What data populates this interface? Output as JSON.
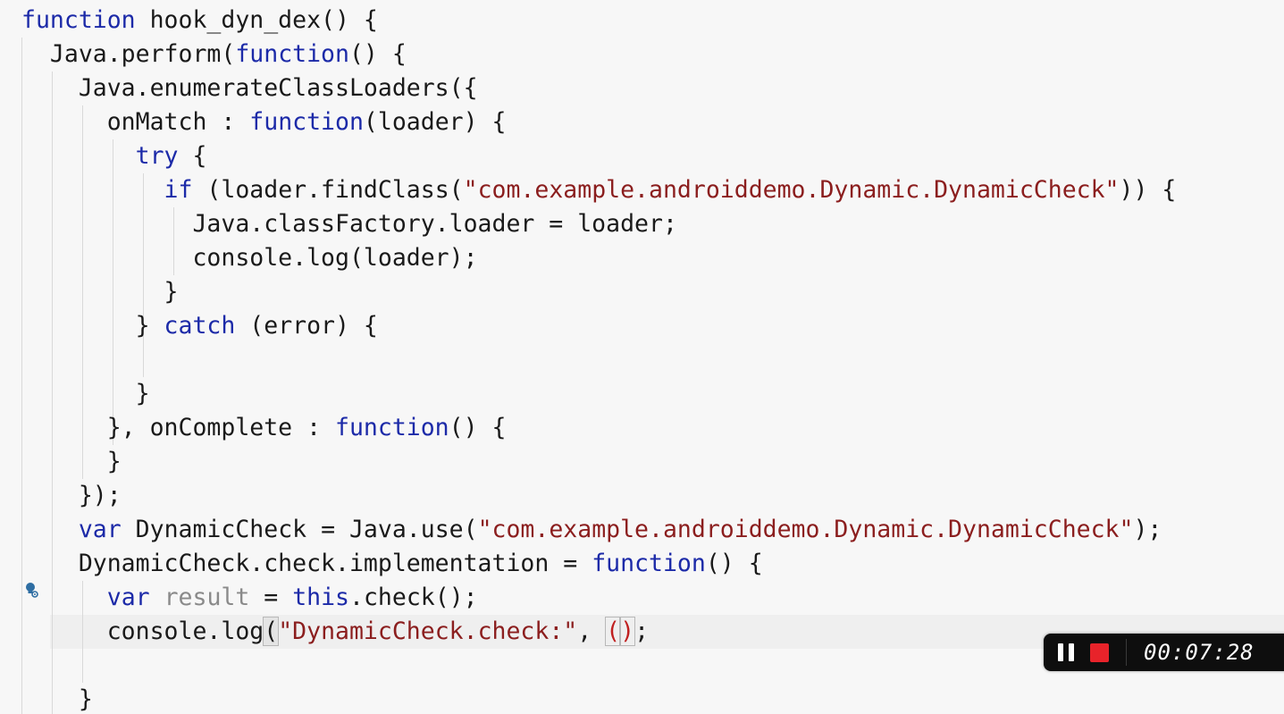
{
  "code_lines": [
    [
      {
        "t": "function",
        "c": "kw"
      },
      {
        "t": " hook_dyn_dex() {"
      }
    ],
    [
      {
        "t": "  Java.perform("
      },
      {
        "t": "function",
        "c": "kw"
      },
      {
        "t": "() {"
      }
    ],
    [
      {
        "t": "    Java.enumerateClassLoaders({"
      }
    ],
    [
      {
        "t": "      onMatch : "
      },
      {
        "t": "function",
        "c": "kw"
      },
      {
        "t": "(loader) {"
      }
    ],
    [
      {
        "t": "        "
      },
      {
        "t": "try",
        "c": "kw"
      },
      {
        "t": " {"
      }
    ],
    [
      {
        "t": "          "
      },
      {
        "t": "if",
        "c": "kw"
      },
      {
        "t": " (loader.findClass("
      },
      {
        "t": "\"com.example.androiddemo.Dynamic.DynamicCheck\"",
        "c": "str"
      },
      {
        "t": ")) {"
      }
    ],
    [
      {
        "t": "            Java.classFactory.loader = loader;"
      }
    ],
    [
      {
        "t": "            console.log(loader);"
      }
    ],
    [
      {
        "t": "          }"
      }
    ],
    [
      {
        "t": "        } "
      },
      {
        "t": "catch",
        "c": "kw"
      },
      {
        "t": " (error) {"
      }
    ],
    [],
    [
      {
        "t": "        }"
      }
    ],
    [
      {
        "t": "      }, onComplete : "
      },
      {
        "t": "function",
        "c": "kw"
      },
      {
        "t": "() {"
      }
    ],
    [
      {
        "t": "      }"
      }
    ],
    [
      {
        "t": "    });"
      }
    ],
    [
      {
        "t": "    "
      },
      {
        "t": "var",
        "c": "kw"
      },
      {
        "t": " DynamicCheck = Java.use("
      },
      {
        "t": "\"com.example.androiddemo.Dynamic.DynamicCheck\"",
        "c": "str"
      },
      {
        "t": ");"
      }
    ],
    [
      {
        "t": "    DynamicCheck.check.implementation = "
      },
      {
        "t": "function",
        "c": "kw"
      },
      {
        "t": "() {"
      }
    ],
    [
      {
        "t": "      "
      },
      {
        "t": "var",
        "c": "kw"
      },
      {
        "t": " "
      },
      {
        "t": "result",
        "c": "unused"
      },
      {
        "t": " = "
      },
      {
        "t": "this",
        "c": "kw"
      },
      {
        "t": ".check();"
      }
    ],
    [
      {
        "t": "      console.log"
      },
      {
        "t": "(",
        "c": "paren-match"
      },
      {
        "t": "\"DynamicCheck.check:\"",
        "c": "str"
      },
      {
        "t": ", "
      },
      {
        "t": "(",
        "c": "paren-hl"
      },
      {
        "caret": true
      },
      {
        "t": ")",
        "c": "paren-hl"
      },
      {
        "t": ";"
      }
    ],
    [],
    [
      {
        "t": "    }"
      }
    ]
  ],
  "status_icon": "lightbulb-gear-icon",
  "recorder": {
    "pause_icon": "pause-icon",
    "stop_icon": "stop-icon",
    "timer": "00:07:28",
    "stop_color": "#e8232a"
  },
  "colors": {
    "keyword": "#1c2aa8",
    "string": "#8b1e1e",
    "unused_variable": "#8a8a8a",
    "background": "#f7f7f7"
  }
}
